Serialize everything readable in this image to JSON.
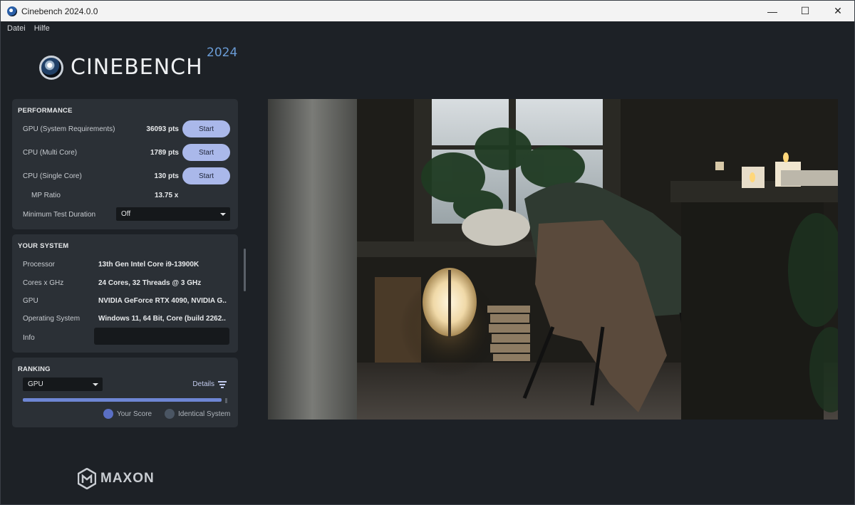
{
  "window": {
    "title": "Cinebench 2024.0.0",
    "controls": [
      "—",
      "☐",
      "✕"
    ]
  },
  "menu": {
    "items": [
      "Datei",
      "Hilfe"
    ]
  },
  "logo": {
    "name": "CINEBENCH",
    "year": "2024"
  },
  "performance": {
    "title": "PERFORMANCE",
    "rows": [
      {
        "label": "GPU (System Requirements)",
        "score": "36093 pts",
        "button": "Start"
      },
      {
        "label": "CPU (Multi Core)",
        "score": "1789 pts",
        "button": "Start"
      },
      {
        "label": "CPU (Single Core)",
        "score": "130 pts",
        "button": "Start"
      }
    ],
    "mp_ratio_label": "MP Ratio",
    "mp_ratio_value": "13.75 x",
    "min_duration_label": "Minimum Test Duration",
    "min_duration_value": "Off"
  },
  "system": {
    "title": "YOUR SYSTEM",
    "rows": [
      {
        "label": "Processor",
        "value": "13th Gen Intel Core i9-13900K"
      },
      {
        "label": "Cores x GHz",
        "value": "24 Cores, 32 Threads @ 3 GHz"
      },
      {
        "label": "GPU",
        "value": "NVIDIA GeForce RTX 4090, NVIDIA G.."
      },
      {
        "label": "Operating System",
        "value": "Windows 11, 64 Bit, Core (build 2262.."
      }
    ],
    "info_label": "Info",
    "info_value": ""
  },
  "ranking": {
    "title": "RANKING",
    "selected": "GPU",
    "details_label": "Details",
    "legend": [
      {
        "label": "Your Score",
        "color": "#5a6fc4"
      },
      {
        "label": "Identical System",
        "color": "#4a5563"
      }
    ],
    "your_score_fraction": 0.97
  },
  "footer": {
    "brand": "MAXON"
  },
  "colors": {
    "accent": "#aab8ea",
    "panel": "#2b3036",
    "background": "#1d2126"
  }
}
